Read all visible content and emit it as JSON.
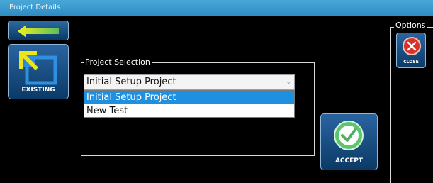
{
  "window": {
    "title": "Project Details"
  },
  "nav": {
    "back_icon": "back-arrow-icon"
  },
  "existing": {
    "label": "EXISTING",
    "icon": "existing-project-icon"
  },
  "project_selection": {
    "group_label": "Project Selection",
    "selected_value": "Initial Setup Project",
    "options": [
      "Initial Setup Project",
      "New Test"
    ],
    "highlighted_option": "Initial Setup Project"
  },
  "accept": {
    "label": "ACCEPT",
    "icon": "checkmark-icon"
  },
  "options_panel": {
    "group_label": "Options",
    "close": {
      "label": "CLOSE",
      "icon": "close-x-icon"
    }
  },
  "colors": {
    "title_bar": "#3a9bd0",
    "button_blue": "#1a4f86",
    "highlight": "#1f8fe0",
    "arrow_yellow": "#e2e820",
    "arrow_green": "#58b85a",
    "close_red": "#d8322b",
    "accept_green": "#5cc56d"
  }
}
